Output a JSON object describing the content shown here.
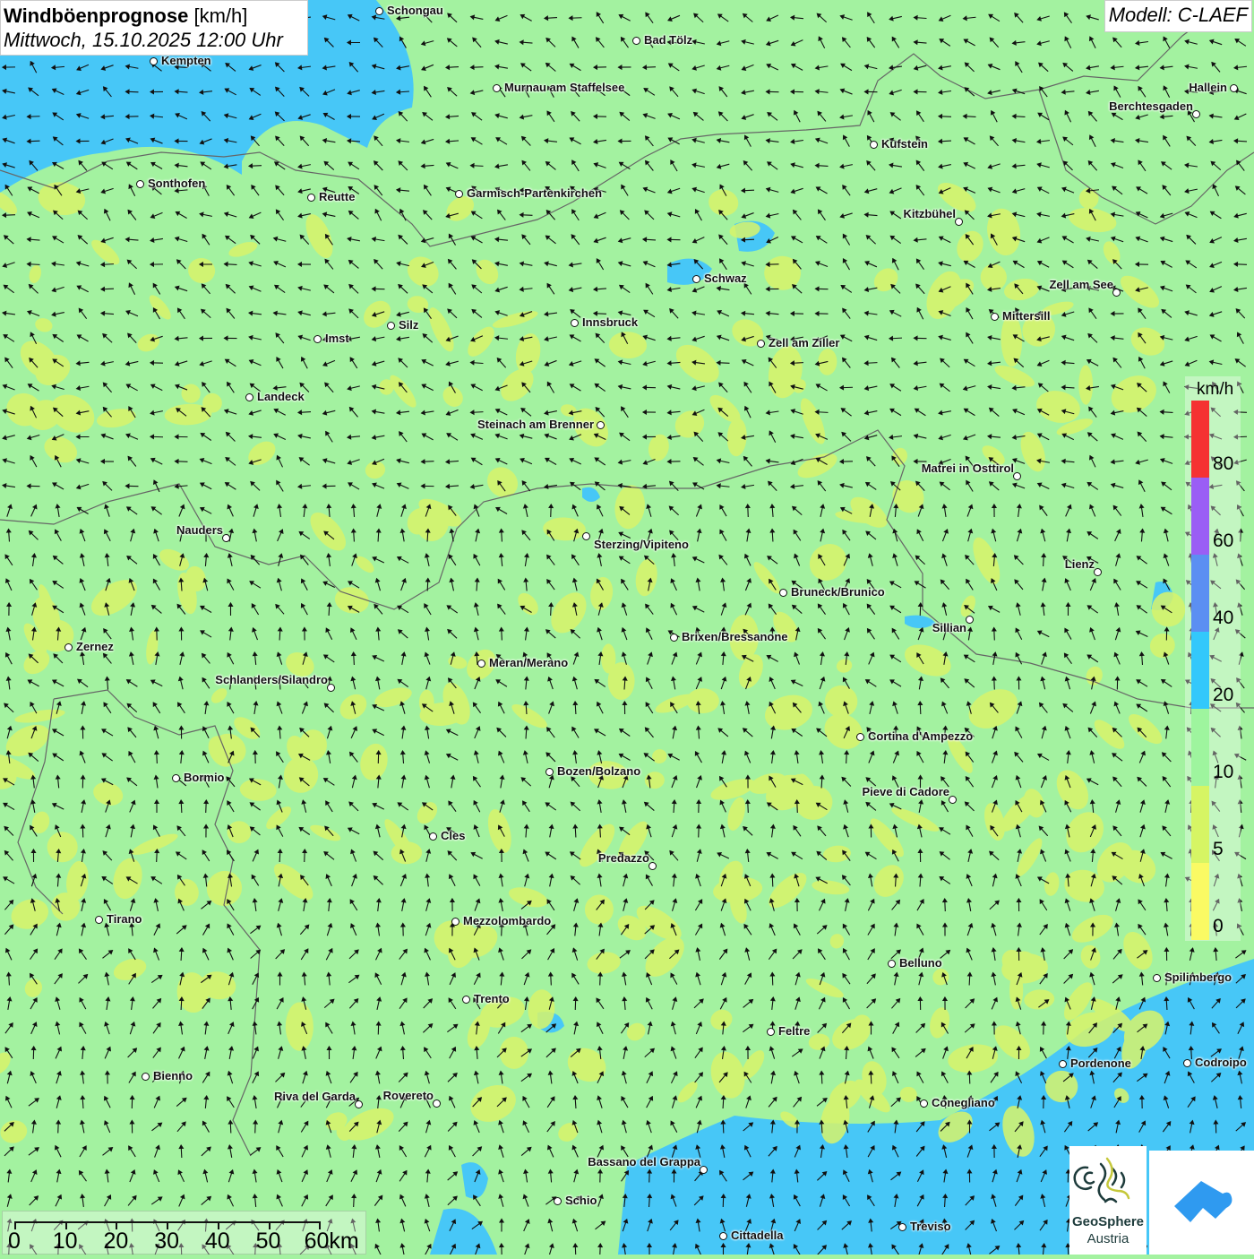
{
  "title": {
    "main": "Windböenprognose",
    "unit": "[km/h]",
    "datetime": "Mittwoch, 15.10.2025 12:00 Uhr"
  },
  "model": "Modell: C-LAEF",
  "legend": {
    "unit": "km/h",
    "bands": [
      {
        "label": "80",
        "color": "#f53232"
      },
      {
        "label": "60",
        "color": "#9a5ef5"
      },
      {
        "label": "40",
        "color": "#5b8ff2"
      },
      {
        "label": "20",
        "color": "#33c8fb"
      },
      {
        "label": "10",
        "color": "#9ef59e"
      },
      {
        "label": "5",
        "color": "#d6f564"
      },
      {
        "label": "0",
        "color": "#fafa64"
      }
    ]
  },
  "scale_bar": {
    "labels": [
      "0",
      "10",
      "20",
      "30",
      "40",
      "50",
      "60km"
    ]
  },
  "logos": {
    "geosphere_line1": "GeoSphere",
    "geosphere_line2": "Austria"
  },
  "cities": [
    "Schongau",
    "Kempten",
    "Bad Tölz",
    "Murnau am Staffelsee",
    "Hallein",
    "Berchtesgaden",
    "Kufstein",
    "Sonthofen",
    "Reutte",
    "Garmisch-Partenkirchen",
    "Kitzbühel",
    "Schwaz",
    "Zell am See",
    "Mittersill",
    "Innsbruck",
    "Silz",
    "Imst",
    "Zell am Ziller",
    "Landeck",
    "Steinach am Brenner",
    "Matrei in Osttirol",
    "Nauders",
    "Sterzing/Vipiteno",
    "Lienz",
    "Bruneck/Brunico",
    "Sillian",
    "Brixen/Bressanone",
    "Zernez",
    "Meran/Merano",
    "Schlanders/Silandro",
    "Cortina d'Ampezzo",
    "Bozen/Bolzano",
    "Bormio",
    "Pieve di Cadore",
    "Cles",
    "Predazzo",
    "Tirano",
    "Mezzolombardo",
    "Belluno",
    "Spilimbergo",
    "Trento",
    "Feltre",
    "Pordenone",
    "Codroipo",
    "Bienno",
    "Riva del Garda",
    "Rovereto",
    "Conegliano",
    "Bassano del Grappa",
    "Schio",
    "Treviso",
    "Cittadella"
  ]
}
